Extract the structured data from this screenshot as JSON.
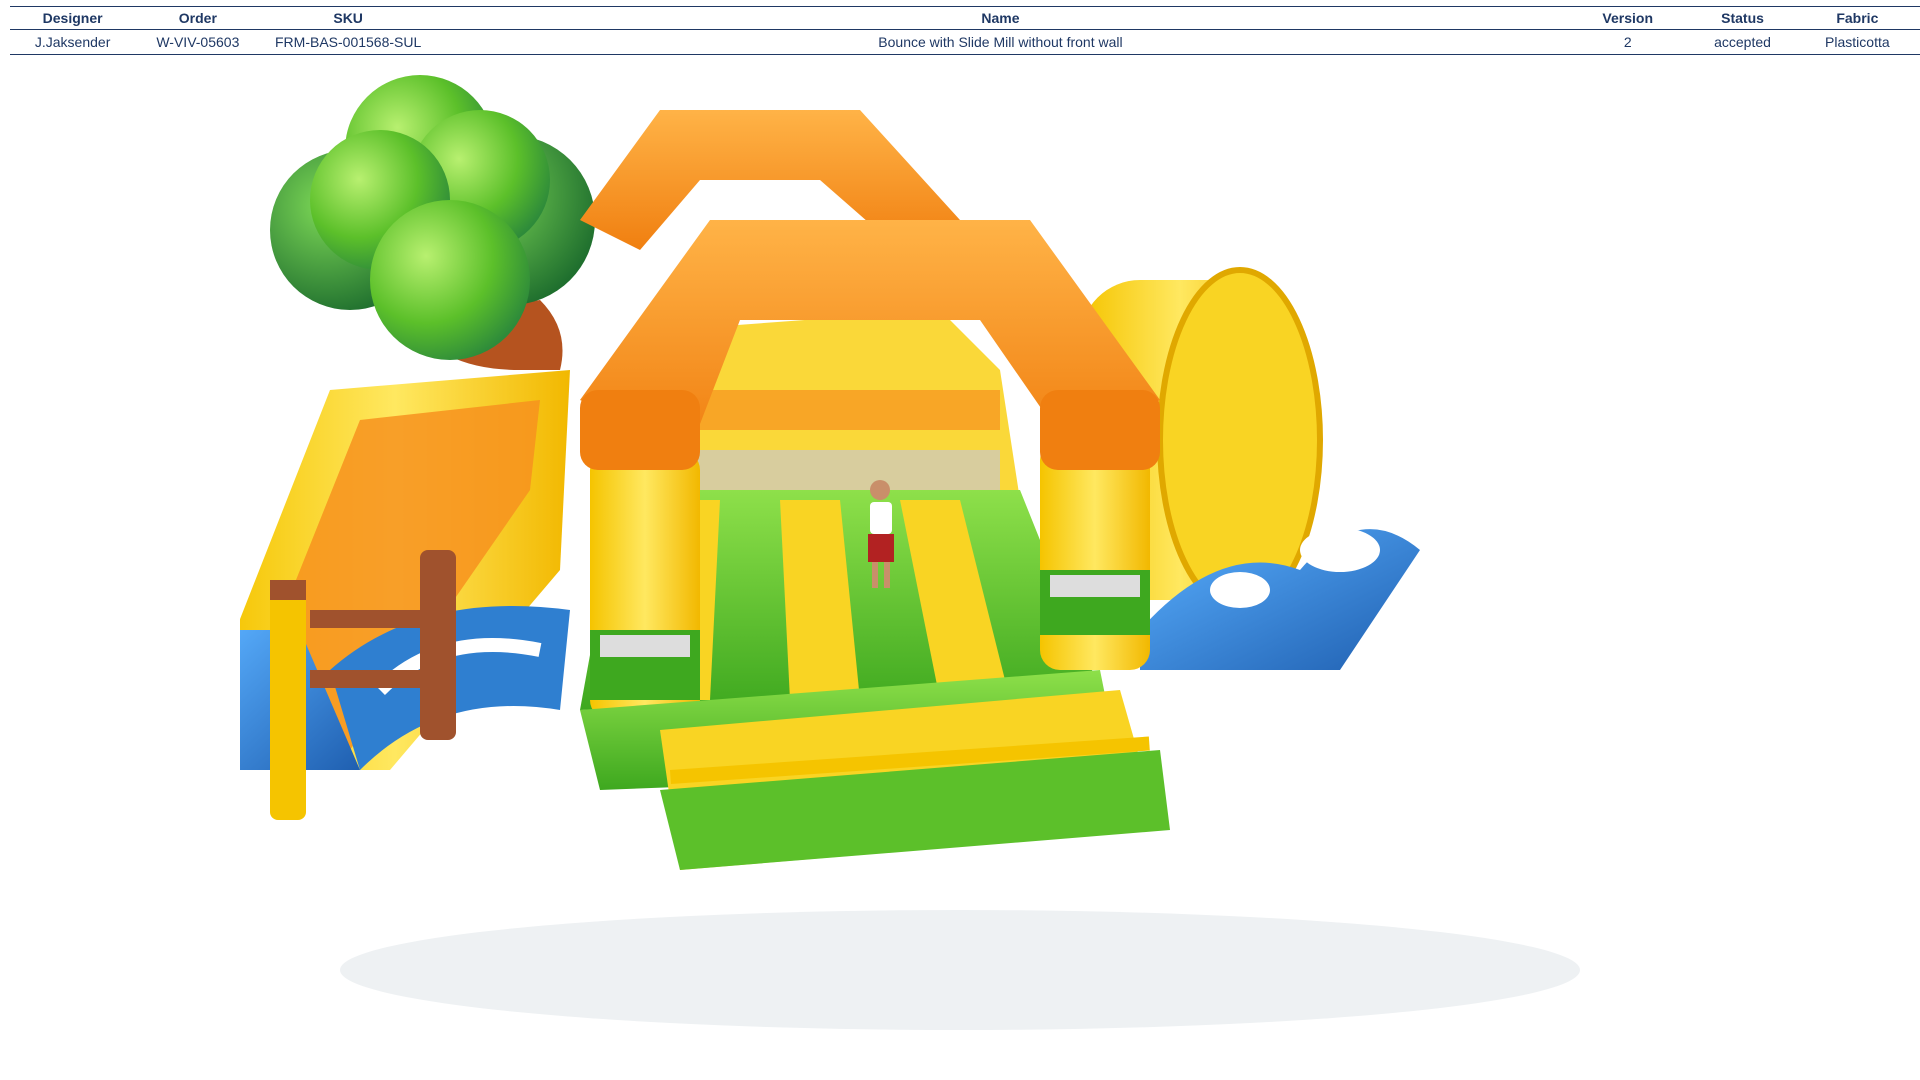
{
  "spec_table": {
    "headers": {
      "designer": "Designer",
      "order": "Order",
      "sku": "SKU",
      "name": "Name",
      "version": "Version",
      "status": "Status",
      "fabric": "Fabric"
    },
    "row": {
      "designer": "J.Jaksender",
      "order": "W-VIV-05603",
      "sku": "FRM-BAS-001568-SUL",
      "name": "Bounce with Slide Mill without front wall",
      "version": "2",
      "status": "accepted",
      "fabric": "Plasticotta"
    }
  },
  "colors": {
    "text": "#1f3864",
    "orange": "#f7921e",
    "yellow": "#f9d423",
    "green": "#5cc02a",
    "dark_green": "#2e8b3a",
    "blue": "#2f7fd0",
    "brown": "#a0522d"
  }
}
